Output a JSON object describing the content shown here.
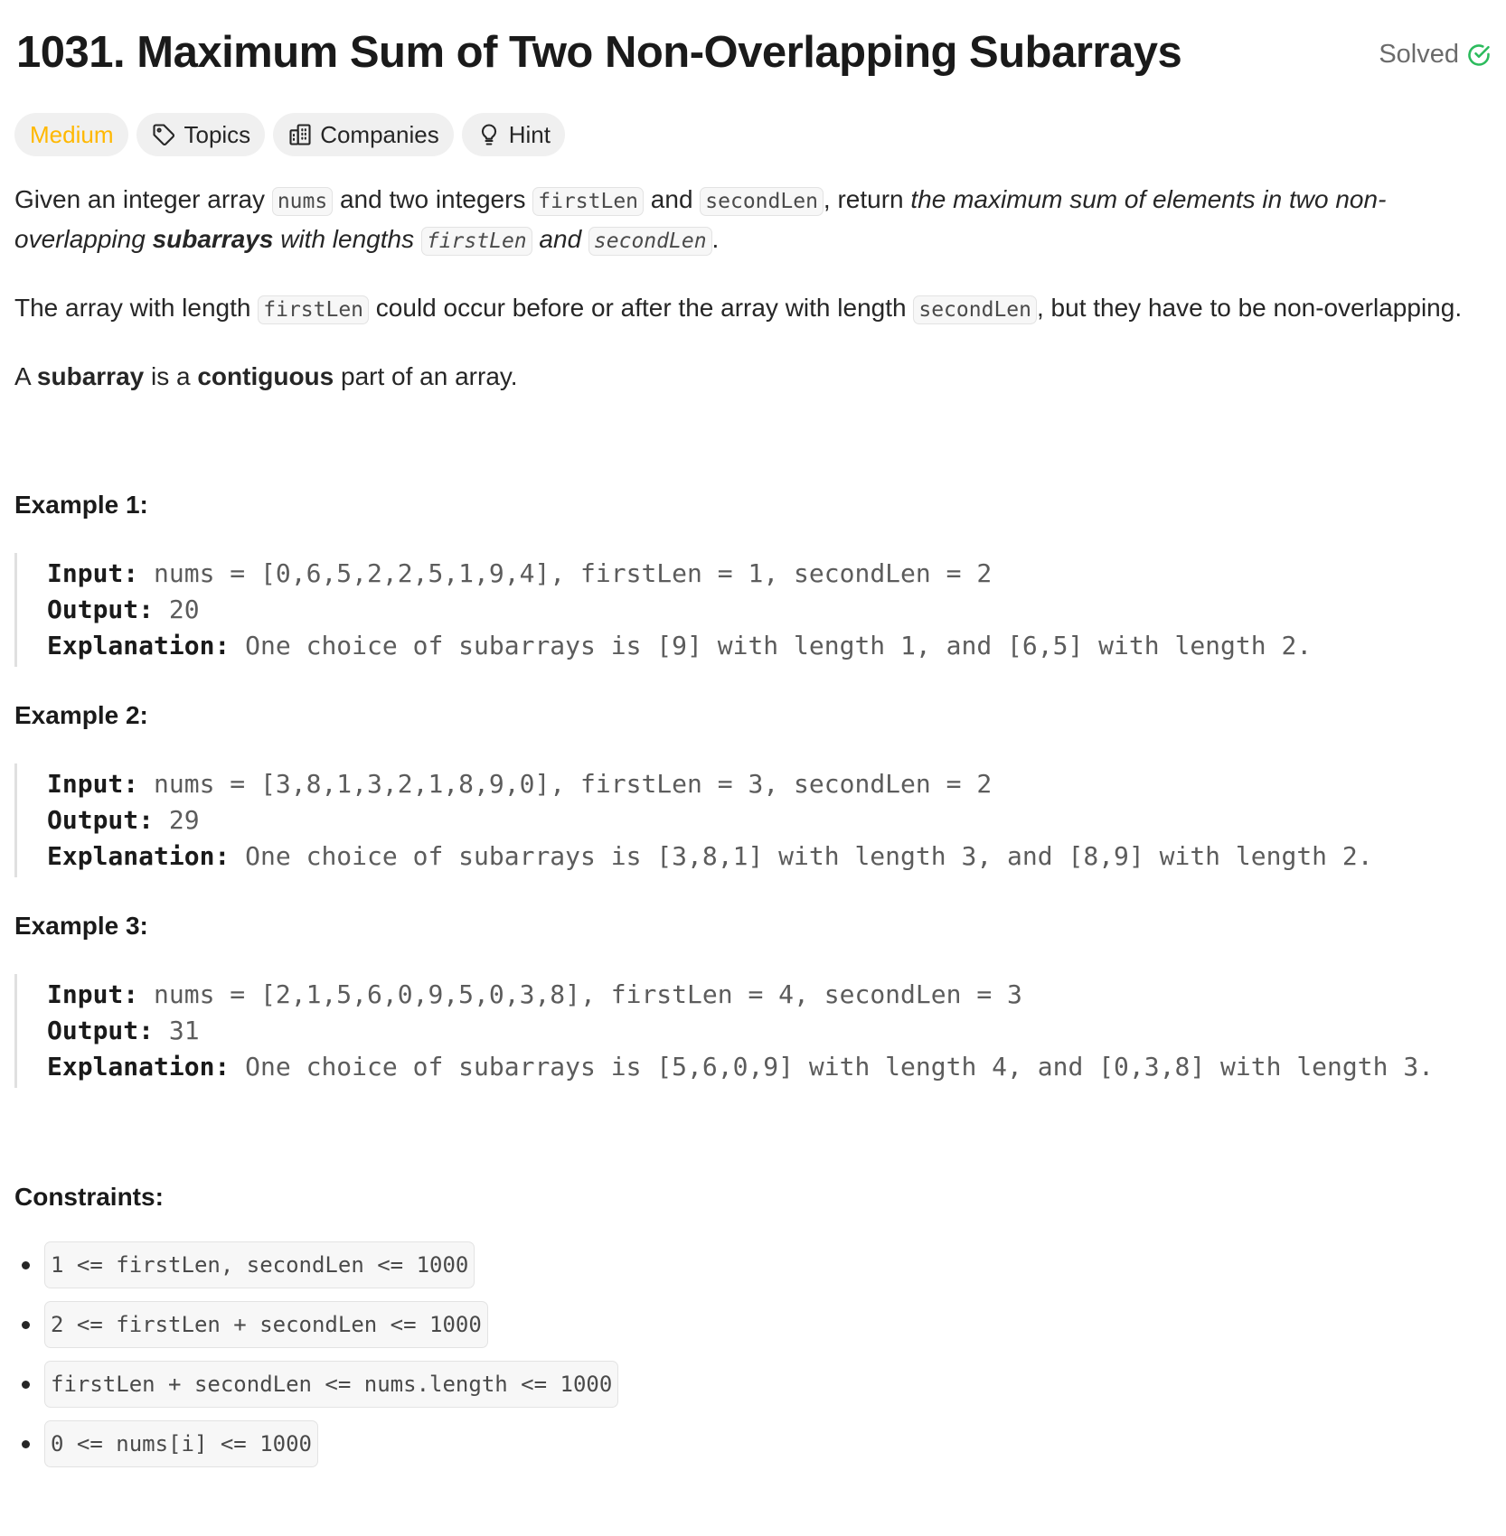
{
  "problem": {
    "number": "1031.",
    "name": "Maximum Sum of Two Non-Overlapping Subarrays",
    "status": "Solved",
    "status_color": "#2cbb5d"
  },
  "tags": {
    "difficulty": "Medium",
    "difficulty_color": "#ffb800",
    "topics": "Topics",
    "companies": "Companies",
    "hint": "Hint"
  },
  "description": {
    "p1": {
      "t1": "Given an integer array ",
      "c1": "nums",
      "t2": " and two integers ",
      "c2": "firstLen",
      "t3": " and ",
      "c3": "secondLen",
      "t4": ", return ",
      "em1": "the maximum sum of elements in two non-overlapping ",
      "strong1": "subarrays",
      "em2": " with lengths ",
      "c4": "firstLen",
      "em3": " and ",
      "c5": "secondLen",
      "t5": "."
    },
    "p2": {
      "t1": "The array with length ",
      "c1": "firstLen",
      "t2": " could occur before or after the array with length ",
      "c2": "secondLen",
      "t3": ", but they have to be non-overlapping."
    },
    "p3": {
      "t1": "A ",
      "b1": "subarray",
      "t2": " is a ",
      "b2": "contiguous",
      "t3": " part of an array."
    }
  },
  "examples": [
    {
      "title": "Example 1:",
      "input_label": "Input:",
      "input": "nums = [0,6,5,2,2,5,1,9,4], firstLen = 1, secondLen = 2",
      "output_label": "Output:",
      "output": "20",
      "explanation_label": "Explanation:",
      "explanation": "One choice of subarrays is [9] with length 1, and [6,5] with length 2."
    },
    {
      "title": "Example 2:",
      "input_label": "Input:",
      "input": "nums = [3,8,1,3,2,1,8,9,0], firstLen = 3, secondLen = 2",
      "output_label": "Output:",
      "output": "29",
      "explanation_label": "Explanation:",
      "explanation": "One choice of subarrays is [3,8,1] with length 3, and [8,9] with length 2."
    },
    {
      "title": "Example 3:",
      "input_label": "Input:",
      "input": "nums = [2,1,5,6,0,9,5,0,3,8], firstLen = 4, secondLen = 3",
      "output_label": "Output:",
      "output": "31",
      "explanation_label": "Explanation:",
      "explanation": "One choice of subarrays is [5,6,0,9] with length 4, and [0,3,8] with length 3."
    }
  ],
  "constraints": {
    "title": "Constraints:",
    "items": [
      "1 <= firstLen, secondLen <= 1000",
      "2 <= firstLen + secondLen <= 1000",
      "firstLen + secondLen <= nums.length <= 1000",
      "0 <= nums[i] <= 1000"
    ]
  }
}
